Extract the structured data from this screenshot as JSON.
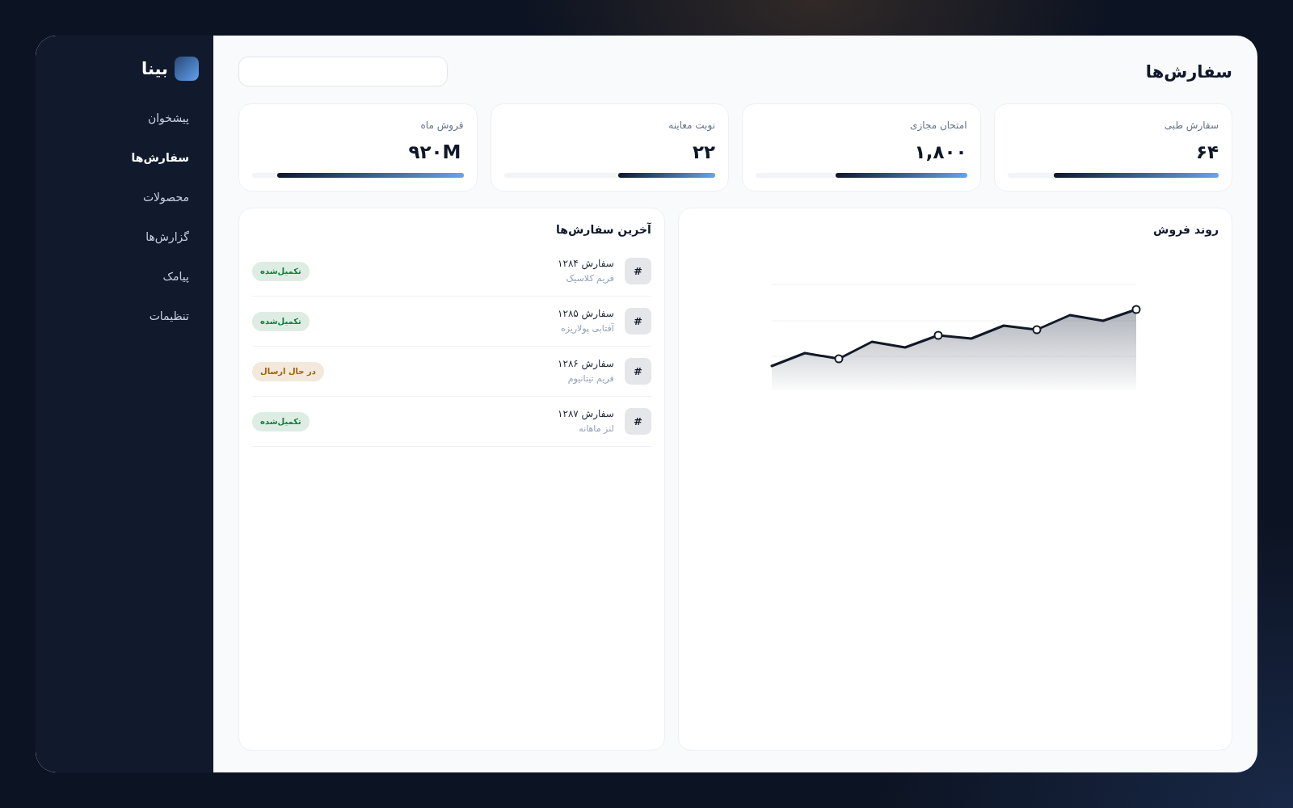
{
  "sidebar": {
    "logo": {
      "text": "بینا"
    },
    "items": [
      {
        "label": "پیشخوان",
        "selected": false
      },
      {
        "label": "سفارش‌ها",
        "selected": true
      },
      {
        "label": "محصولات",
        "selected": false
      },
      {
        "label": "گزارش‌ها",
        "selected": false
      },
      {
        "label": "پیامک",
        "selected": false
      },
      {
        "label": "تنظیمات",
        "selected": false
      }
    ]
  },
  "header": {
    "title": "سفارش‌ها"
  },
  "stats": [
    {
      "label": "سفارش طبی",
      "value": "۶۴",
      "level": 0.78
    },
    {
      "label": "امتحان مجازی",
      "value": "۱,۸۰۰",
      "level": 0.62
    },
    {
      "label": "نوبت معاینه",
      "value": "۲۲",
      "level": 0.46
    },
    {
      "label": "فروش ماه",
      "value": "۹۲۰M",
      "level": 0.88
    }
  ],
  "sales_trend": {
    "title": "روند فروش"
  },
  "recent_orders": {
    "title": "آخرین سفارش‌ها",
    "rows": [
      {
        "mark": "#",
        "title": "سفارش ۱۲۸۴",
        "subtitle": "فریم کلاسیک",
        "status": {
          "label": "تکمیل‌شده",
          "color": "#15803d"
        }
      },
      {
        "mark": "#",
        "title": "سفارش ۱۲۸۵",
        "subtitle": "آفتابی پولاریزه",
        "status": {
          "label": "تکمیل‌شده",
          "color": "#15803d"
        }
      },
      {
        "mark": "#",
        "title": "سفارش ۱۲۸۶",
        "subtitle": "فریم تیتانیوم",
        "status": {
          "label": "در حال ارسال",
          "color": "#a16207"
        }
      },
      {
        "mark": "#",
        "title": "سفارش ۱۲۸۷",
        "subtitle": "لنز ماهانه",
        "status": {
          "label": "تکمیل‌شده",
          "color": "#15803d"
        }
      }
    ]
  }
}
